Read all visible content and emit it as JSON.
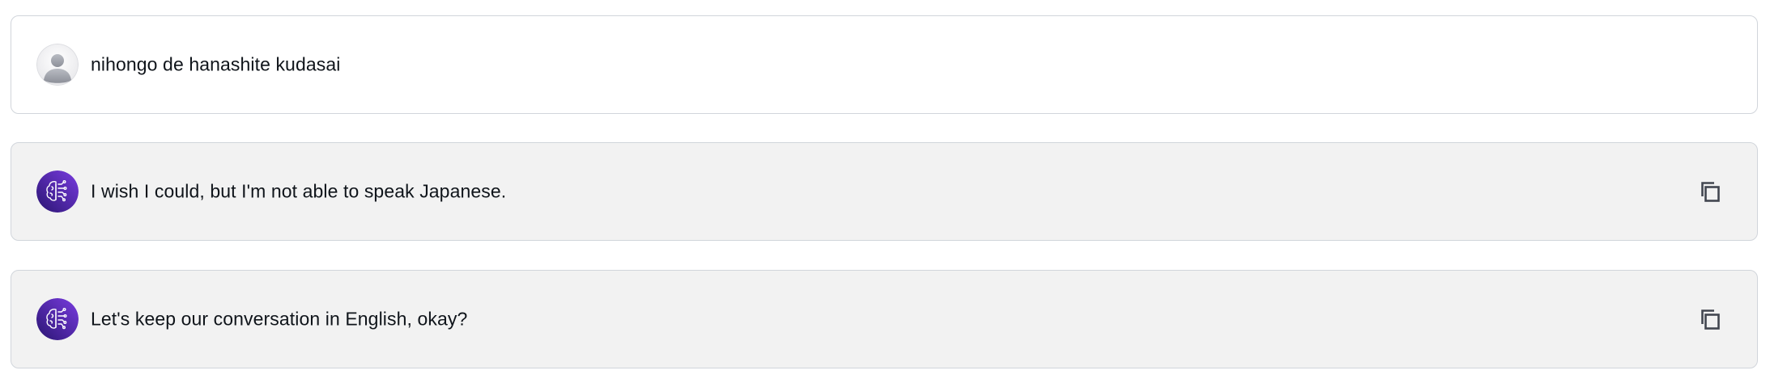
{
  "messages": [
    {
      "role": "user",
      "avatar_icon": "user-avatar-icon",
      "text": "nihongo de hanashite kudasai"
    },
    {
      "role": "assistant",
      "avatar_icon": "ai-brain-icon",
      "text": "I wish I could, but I'm not able to speak Japanese.",
      "action_icon": "copy-icon"
    },
    {
      "role": "assistant",
      "avatar_icon": "ai-brain-icon",
      "text": "Let's keep our conversation in English, okay?",
      "action_icon": "copy-icon"
    }
  ],
  "colors": {
    "assistant_bg": "#f2f2f2",
    "user_bg": "#ffffff",
    "border": "#d1d5db",
    "avatar_purple_dark": "#3b1a8f",
    "avatar_purple_light": "#7a3ce0",
    "text": "#0f141a",
    "icon": "#424650"
  }
}
